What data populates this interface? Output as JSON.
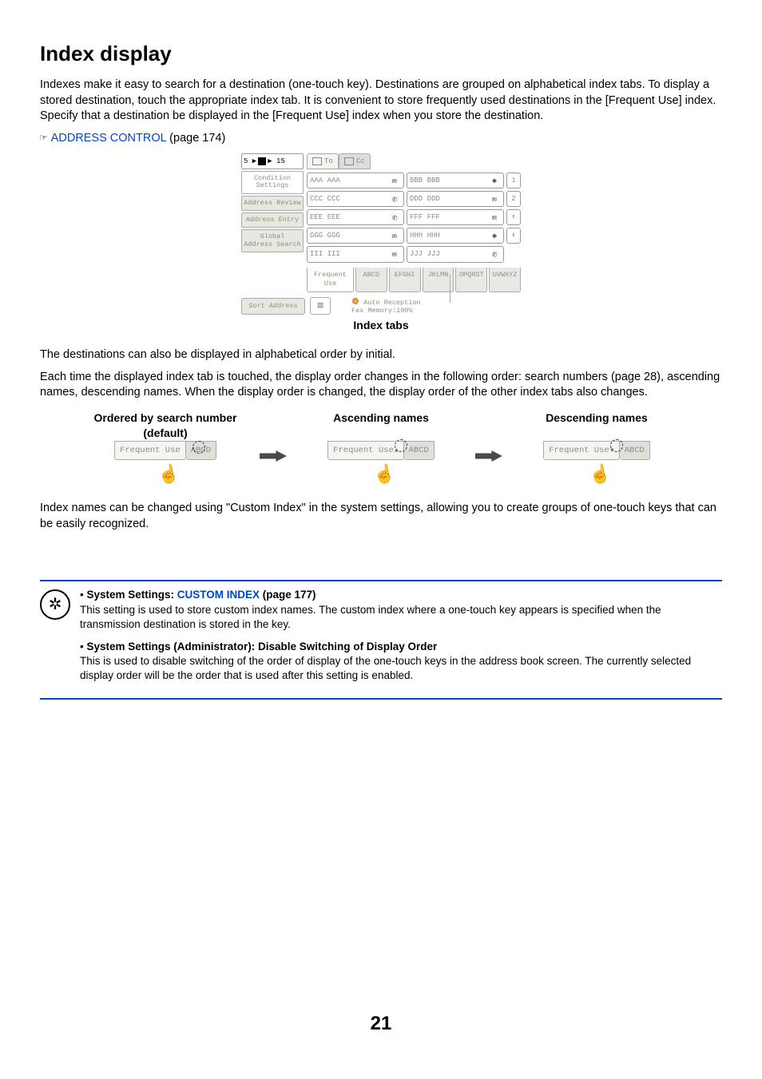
{
  "page": {
    "title": "Index display",
    "paragraph1": "Indexes make it easy to search for a destination (one-touch key). Destinations are grouped on alphabetical index tabs. To display a stored destination, touch the appropriate index tab. It is convenient to store frequently used destinations in the [Frequent Use] index. Specify that a destination be displayed in the [Frequent Use] index when you store the destination.",
    "crossref_symbol": "☞",
    "crossref_link": "ADDRESS CONTROL",
    "crossref_page": " (page 174)",
    "screenshot": {
      "topleft": "5 ▶",
      "topleft2": "▶ 15",
      "side": {
        "cond": "Condition\nSettings",
        "review": "Address Review",
        "entry": "Address Entry",
        "global": "Global\nAddress Search"
      },
      "to": "To",
      "cc": "Cc",
      "addresses": {
        "a": "AAA AAA",
        "b": "BBB BBB",
        "c": "CCC CCC",
        "d": "DDD DDD",
        "e": "EEE EEE",
        "f": "FFF FFF",
        "g": "GGG GGG",
        "h": "HHH HHH",
        "i": "III III",
        "j": "JJJ JJJ"
      },
      "pg1": "1",
      "pg2": "2",
      "up": "⬆",
      "down": "⬇",
      "tabs": {
        "freq": "Frequent Use",
        "abcd": "ABCD",
        "efghi": "EFGHI",
        "jklmn": "JKLMN",
        "opqrst": "OPQRST",
        "uvwxyz": "UVWXYZ"
      },
      "sort": "Sort Address",
      "status_line1": "Auto Reception",
      "status_line2": "Fax Memory:100%"
    },
    "index_tabs_label": "Index tabs",
    "paragraph2": "The destinations can also be displayed in alphabetical order by initial.",
    "paragraph3": "Each time the displayed index tab is touched, the display order changes in the following order: search numbers (page 28), ascending names, descending names. When the display order is changed, the display order of the other index tabs also changes.",
    "ordering": {
      "col1_title": "Ordered by search number (default)",
      "col2_title": "Ascending names",
      "col3_title": "Descending names",
      "freq": "Frequent Use",
      "abcd": "ABCD"
    },
    "paragraph4": "Index names can be changed using \"Custom Index\" in the system settings, allowing you to create groups of one-touch keys that can be easily recognized.",
    "info": {
      "item1_heading_prefix": "System Settings: ",
      "item1_link": "CUSTOM INDEX",
      "item1_heading_suffix": " (page 177)",
      "item1_body": "This setting is used to store custom index names. The custom index where a one-touch key appears is specified when the transmission destination is stored in the key.",
      "item2_heading": "System Settings (Administrator): Disable Switching of Display Order",
      "item2_body": "This is used to disable switching of the order of display of the one-touch keys in the address book screen. The currently selected display order will be the order that is used after this setting is enabled."
    },
    "page_number": "21"
  }
}
